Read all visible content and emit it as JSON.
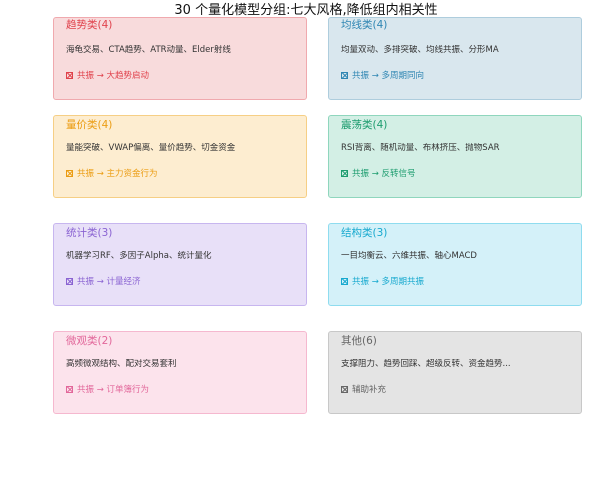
{
  "title": "30 个量化模型分组:七大风格,降低组内相关性",
  "groups": [
    {
      "name": "趋势类(4)",
      "items": "海龟交易、CTA趋势、ATR动量、Elder射线",
      "note": "共振 → 大趋势启动",
      "bg": "#f8dbdc",
      "border": "#f0a9ae",
      "accent": "#e0414b"
    },
    {
      "name": "均线类(4)",
      "items": "均量双动、多排突破、均线共振、分形MA",
      "note": "共振 → 多周期同向",
      "bg": "#d9e7ee",
      "border": "#aecddd",
      "accent": "#2f86b3"
    },
    {
      "name": "量价类(4)",
      "items": "量能突破、VWAP偏离、量价趋势、切金资金",
      "note": "共振 → 主力资金行为",
      "bg": "#fdedd0",
      "border": "#f6cf85",
      "accent": "#eb9c12"
    },
    {
      "name": "震荡类(4)",
      "items": "RSI背离、随机动量、布林挤压、抛物SAR",
      "note": "共振 → 反转信号",
      "bg": "#d3efe5",
      "border": "#8fd6bd",
      "accent": "#1c9c6e"
    },
    {
      "name": "统计类(3)",
      "items": "机器学习RF、多因子Alpha、统计量化",
      "note": "共振 → 计量经济",
      "bg": "#e8e0f8",
      "border": "#c7b6ef",
      "accent": "#8a63d2"
    },
    {
      "name": "结构类(3)",
      "items": "一目均衡云、六维共振、轴心MACD",
      "note": "共振 → 多周期共振",
      "bg": "#d4f1f9",
      "border": "#8fdcef",
      "accent": "#17a9cf"
    },
    {
      "name": "微观类(2)",
      "items": "高频微观结构、配对交易套利",
      "note": "共振 → 订单簿行为",
      "bg": "#fce3ec",
      "border": "#f5b8cf",
      "accent": "#e2679a"
    },
    {
      "name": "其他(6)",
      "items": "支撑阻力、趋势回踩、超级反转、资金趋势...",
      "note": "辅助补充",
      "bg": "#e4e4e4",
      "border": "#c8c8c8",
      "accent": "#666666"
    }
  ]
}
